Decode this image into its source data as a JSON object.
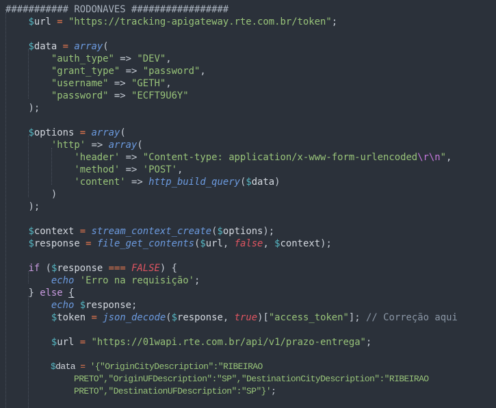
{
  "editor": {
    "language": "php",
    "theme_colors": {
      "background": "#2b313a",
      "variable_sigil": "#56b6c2",
      "operator": "#e6784e",
      "string": "#98c379",
      "function": "#6c9be0",
      "boolean": "#e05561",
      "keyword": "#c99be0",
      "comment": "#8b97a6"
    },
    "lines": {
      "l1": "########### RODONAVES #################",
      "l2_var": "$",
      "l2_name": "url",
      "l2_str": "\"https://tracking-apigateway.rte.com.br/token\"",
      "l4_name": "data",
      "l4_fn": "array",
      "l5_key": "\"auth_type\"",
      "l5_val": "\"DEV\"",
      "l6_key": "\"grant_type\"",
      "l6_val": "\"password\"",
      "l7_key": "\"username\"",
      "l7_val": "\"GETH\"",
      "l8_key": "\"password\"",
      "l8_val": "\"ECFT9U6Y\"",
      "l11_name": "options",
      "l12_key": "'http'",
      "l13_key": "'header'",
      "l13_val": "\"Content-type: application/x-www-form-urlencoded",
      "l13_esc": "\\r\\n",
      "l14_key": "'method'",
      "l14_val": "'POST'",
      "l15_key": "'content'",
      "l15_fn": "http_build_query",
      "l15_arg": "data",
      "l19_name": "context",
      "l19_fn": "stream_context_create",
      "l19_arg": "options",
      "l20_name": "response",
      "l20_fn": "file_get_contents",
      "l20_arg1": "url",
      "l20_bool": "false",
      "l20_arg2": "context",
      "l22_kw": "if",
      "l22_name": "response",
      "l22_op": "===",
      "l22_bool": "FALSE",
      "l23_fn": "echo",
      "l23_str": "'Erro na requisição'",
      "l24_kw": "else",
      "l25_fn": "echo",
      "l25_name": "response",
      "l26_name": "token",
      "l26_fn": "json_decode",
      "l26_arg": "response",
      "l26_bool": "true",
      "l26_key": "\"access_token\"",
      "l26_comment": "// Correção aqui",
      "l28_name": "url",
      "l28_str": "\"https://01wapi.rte.com.br/api/v1/prazo-entrega\"",
      "l30_name": "data",
      "l30_str": "'{\"OriginCityDescription\":\"RIBEIRAO",
      "l31_str": "PRETO\",\"OriginUFDescription\":\"SP\",\"DestinationCityDescription\":\"RIBEIRAO",
      "l32_str": "PRETO\",\"DestinationUFDescription\":\"SP\"}'"
    }
  }
}
